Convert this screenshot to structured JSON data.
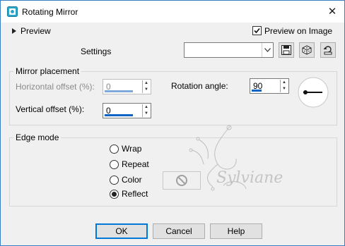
{
  "window": {
    "title": "Rotating Mirror",
    "close_glyph": "✕"
  },
  "preview": {
    "label": "Preview",
    "arrow_icon": "triangle-right-icon"
  },
  "preview_on_image": {
    "label": "Preview on Image",
    "checked": true
  },
  "settings": {
    "label": "Settings",
    "dropdown_value": ""
  },
  "mirror_placement": {
    "title": "Mirror placement",
    "horizontal_offset": {
      "label": "Horizontal offset (%):",
      "value": "0",
      "enabled": false
    },
    "vertical_offset": {
      "label": "Vertical offset (%):",
      "value": "0",
      "enabled": true
    },
    "rotation_angle": {
      "label": "Rotation angle:",
      "value": "90"
    }
  },
  "edge_mode": {
    "title": "Edge mode",
    "options": [
      "Wrap",
      "Repeat",
      "Color",
      "Reflect"
    ],
    "selected": "Reflect"
  },
  "watermark": {
    "text": "Sylviane"
  },
  "buttons": {
    "ok": "OK",
    "cancel": "Cancel",
    "help": "Help"
  }
}
